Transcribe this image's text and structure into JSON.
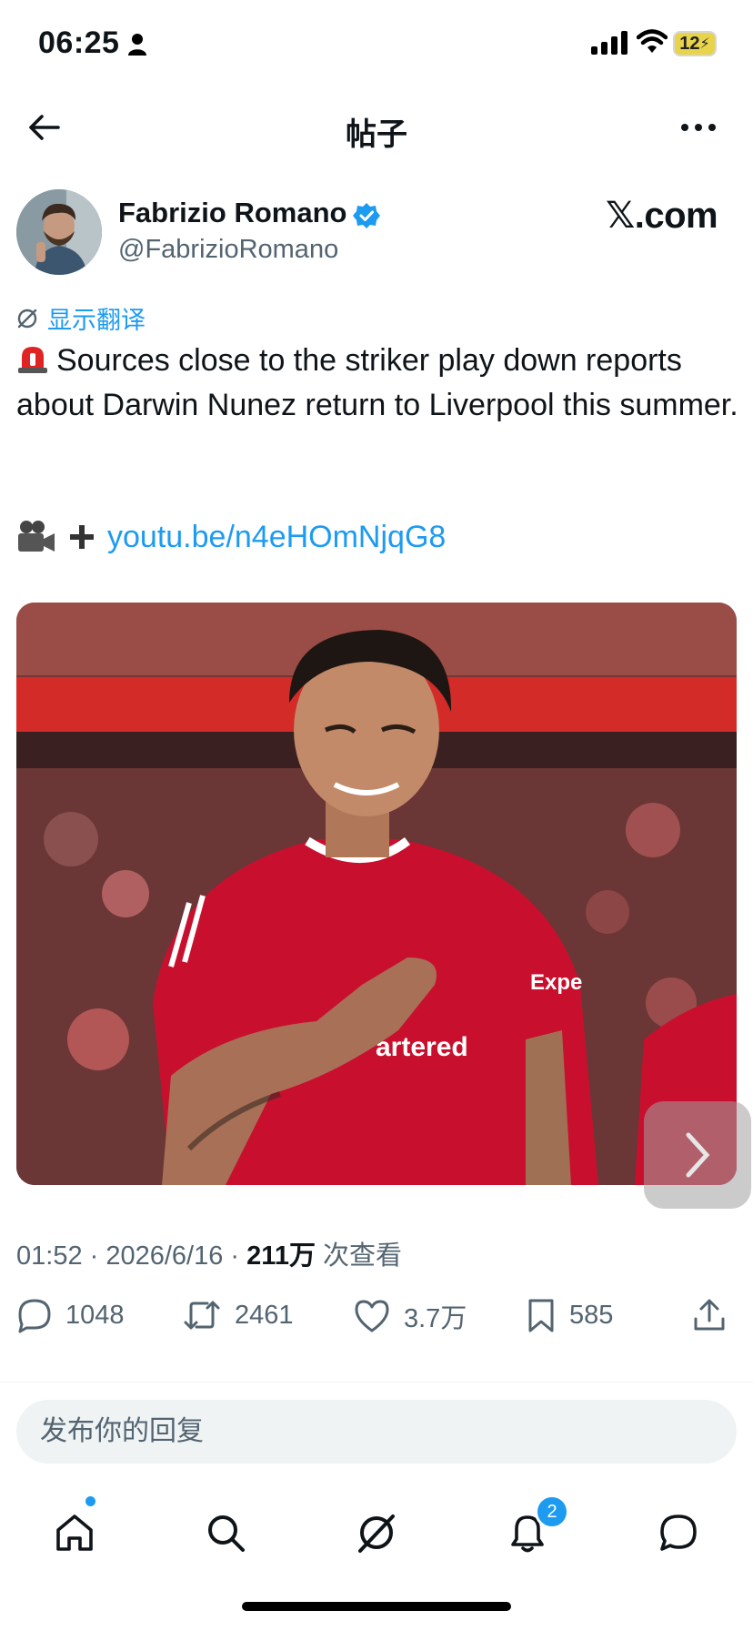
{
  "status_bar": {
    "time": "06:25",
    "battery": "12"
  },
  "header": {
    "title": "帖子"
  },
  "author": {
    "name": "Fabrizio Romano",
    "handle": "@FabrizioRomano",
    "brand": "𝕏.com"
  },
  "translate_label": "显示翻译",
  "tweet": {
    "text": "Sources close to the striker play down reports about Darwin Nunez return to Liverpool this summer.",
    "link": "youtu.be/n4eHOmNjqG8"
  },
  "media": {
    "sponsor_text": "artered",
    "sponsor_text_2": "Expe"
  },
  "meta": {
    "time": "01:52",
    "sep1": " · ",
    "date": "2026/6/16",
    "sep2": " · ",
    "views": "211万",
    "views_suffix": " 次查看"
  },
  "actions": {
    "replies": "1048",
    "reposts": "2461",
    "likes": "3.7万",
    "bookmarks": "585"
  },
  "reply": {
    "placeholder": "发布你的回复"
  },
  "nav": {
    "notifications_badge": "2"
  },
  "colors": {
    "accent": "#1d9bf0",
    "secondary_text": "#536471",
    "jersey_red": "#c8102e"
  }
}
